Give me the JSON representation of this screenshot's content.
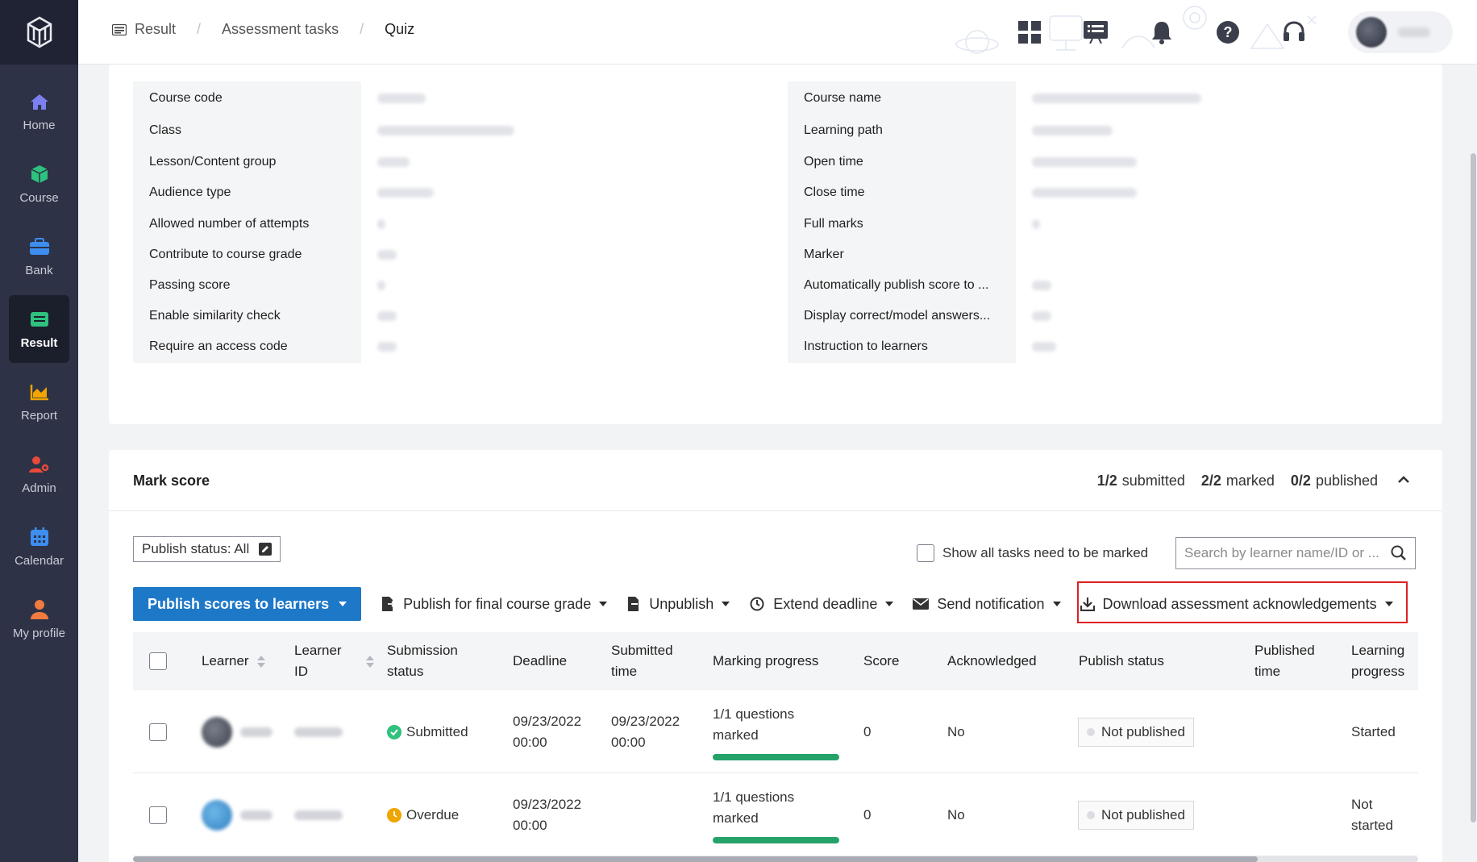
{
  "sidebar": {
    "items": [
      {
        "label": "Home",
        "icon": "home-icon",
        "color": "#7b7ff0"
      },
      {
        "label": "Course",
        "icon": "cube-icon",
        "color": "#2ec27e"
      },
      {
        "label": "Bank",
        "icon": "briefcase-icon",
        "color": "#3d8ef0"
      },
      {
        "label": "Result",
        "icon": "result-icon",
        "color": "#2ec27e",
        "active": true
      },
      {
        "label": "Report",
        "icon": "chart-icon",
        "color": "#f0a500"
      },
      {
        "label": "Admin",
        "icon": "admin-icon",
        "color": "#e84a3c"
      },
      {
        "label": "Calendar",
        "icon": "calendar-icon",
        "color": "#3d8ef0"
      },
      {
        "label": "My profile",
        "icon": "person-icon",
        "color": "#f07b3f"
      }
    ]
  },
  "header": {
    "breadcrumb": [
      "Result",
      "Assessment tasks",
      "Quiz"
    ]
  },
  "details": {
    "left": [
      {
        "label": "Course code"
      },
      {
        "label": "Class"
      },
      {
        "label": "Lesson/Content group"
      },
      {
        "label": "Audience type"
      },
      {
        "label": "Allowed number of attempts"
      },
      {
        "label": "Contribute to course grade"
      },
      {
        "label": "Passing score"
      },
      {
        "label": "Enable similarity check"
      },
      {
        "label": "Require an access code"
      }
    ],
    "right": [
      {
        "label": "Course name"
      },
      {
        "label": "Learning path"
      },
      {
        "label": "Open time"
      },
      {
        "label": "Close time"
      },
      {
        "label": "Full marks"
      },
      {
        "label": "Marker"
      },
      {
        "label": "Automatically publish score to ..."
      },
      {
        "label": "Display correct/model answers..."
      },
      {
        "label": "Instruction to learners"
      }
    ]
  },
  "mark_score": {
    "title": "Mark score",
    "stats": {
      "submitted_count": "1/2",
      "submitted_label": "submitted",
      "marked_count": "2/2",
      "marked_label": "marked",
      "published_count": "0/2",
      "published_label": "published"
    },
    "filter_label": "Publish status: All",
    "show_all_label": "Show all tasks need to be marked",
    "search_placeholder": "Search by learner name/ID or ...",
    "actions": {
      "publish_scores": "Publish scores to learners",
      "publish_final": "Publish for final course grade",
      "unpublish": "Unpublish",
      "extend": "Extend deadline",
      "notify": "Send notification",
      "download": "Download assessment acknowledgements"
    },
    "columns": {
      "learner": "Learner",
      "learner_id_1": "Learner",
      "learner_id_2": "ID",
      "submission_1": "Submission",
      "submission_2": "status",
      "deadline": "Deadline",
      "submitted_1": "Submitted",
      "submitted_2": "time",
      "marking": "Marking progress",
      "score": "Score",
      "ack": "Acknowledged",
      "publish_status": "Publish status",
      "published_1": "Published",
      "published_2": "time",
      "learning_1": "Learning",
      "learning_2": "progress"
    },
    "rows": [
      {
        "status": "Submitted",
        "status_color": "#2ec27e",
        "deadline_date": "09/23/2022",
        "deadline_time": "00:00",
        "submitted_date": "09/23/2022",
        "submitted_time": "00:00",
        "marking_line1": "1/1 questions",
        "marking_line2": "marked",
        "marking_progress": 1.0,
        "score": "0",
        "ack": "No",
        "publish": "Not published",
        "learning_1": "Started",
        "learning_2": ""
      },
      {
        "status": "Overdue",
        "status_color": "#f0a500",
        "deadline_date": "09/23/2022",
        "deadline_time": "00:00",
        "submitted_date": "",
        "submitted_time": "",
        "marking_line1": "1/1 questions",
        "marking_line2": "marked",
        "marking_progress": 1.0,
        "score": "0",
        "ack": "No",
        "publish": "Not published",
        "learning_1": "Not",
        "learning_2": "started"
      }
    ]
  },
  "colors": {
    "accent": "#1e78c8",
    "progress": "#25a268",
    "highlight_box": "#e02020",
    "sidebar_bg": "#2d3246"
  }
}
